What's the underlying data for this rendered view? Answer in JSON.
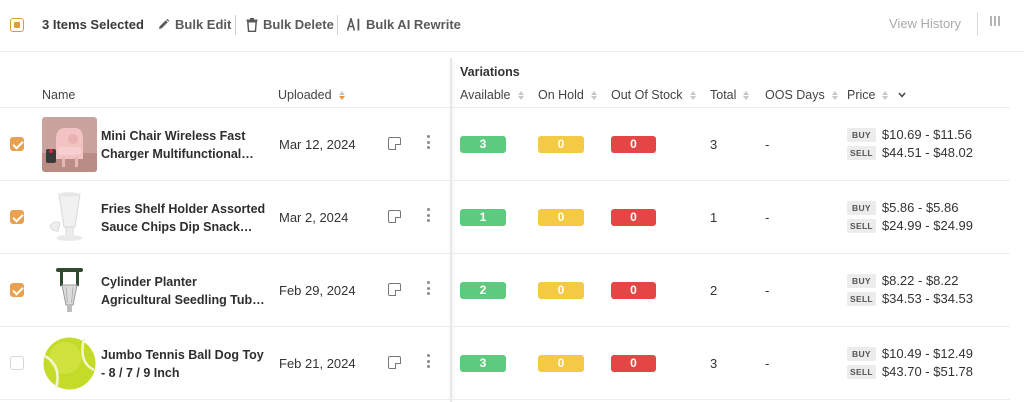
{
  "toolbar": {
    "selected_text": "3 Items Selected",
    "bulk_edit": "Bulk Edit",
    "bulk_delete": "Bulk Delete",
    "bulk_ai_rewrite": "Bulk AI Rewrite",
    "view_history": "View History"
  },
  "headers": {
    "group_variations": "Variations",
    "name": "Name",
    "uploaded": "Uploaded",
    "available": "Available",
    "on_hold": "On Hold",
    "out_of_stock": "Out Of Stock",
    "total": "Total",
    "oos_days": "OOS Days",
    "price": "Price"
  },
  "price_tags": {
    "buy": "BUY",
    "sell": "SELL"
  },
  "accent_colors": {
    "orange": "#e8a24f",
    "green": "#5ccb7f",
    "yellow": "#f4c943",
    "red": "#e44545"
  },
  "rows": [
    {
      "checked": true,
      "name_line1": "Mini Chair Wireless Fast",
      "name_line2": "Charger Multifunctional…",
      "uploaded": "Mar 12, 2024",
      "available": "3",
      "on_hold": "0",
      "out_of_stock": "0",
      "total": "3",
      "oos_days": "-",
      "buy_price": "$10.69 - $11.56",
      "sell_price": "$44.51 - $48.02"
    },
    {
      "checked": true,
      "name_line1": "Fries Shelf Holder Assorted",
      "name_line2": "Sauce Chips Dip Snack…",
      "uploaded": "Mar 2, 2024",
      "available": "1",
      "on_hold": "0",
      "out_of_stock": "0",
      "total": "1",
      "oos_days": "-",
      "buy_price": "$5.86 - $5.86",
      "sell_price": "$24.99 - $24.99"
    },
    {
      "checked": true,
      "name_line1": "Cylinder Planter",
      "name_line2": "Agricultural Seedling Tub…",
      "uploaded": "Feb 29, 2024",
      "available": "2",
      "on_hold": "0",
      "out_of_stock": "0",
      "total": "2",
      "oos_days": "-",
      "buy_price": "$8.22 - $8.22",
      "sell_price": "$34.53 - $34.53"
    },
    {
      "checked": false,
      "name_line1": "Jumbo Tennis Ball Dog Toy",
      "name_line2": "- 8 / 7 / 9 Inch",
      "uploaded": "Feb 21, 2024",
      "available": "3",
      "on_hold": "0",
      "out_of_stock": "0",
      "total": "3",
      "oos_days": "-",
      "buy_price": "$10.49 - $12.49",
      "sell_price": "$43.70 - $51.78"
    }
  ]
}
